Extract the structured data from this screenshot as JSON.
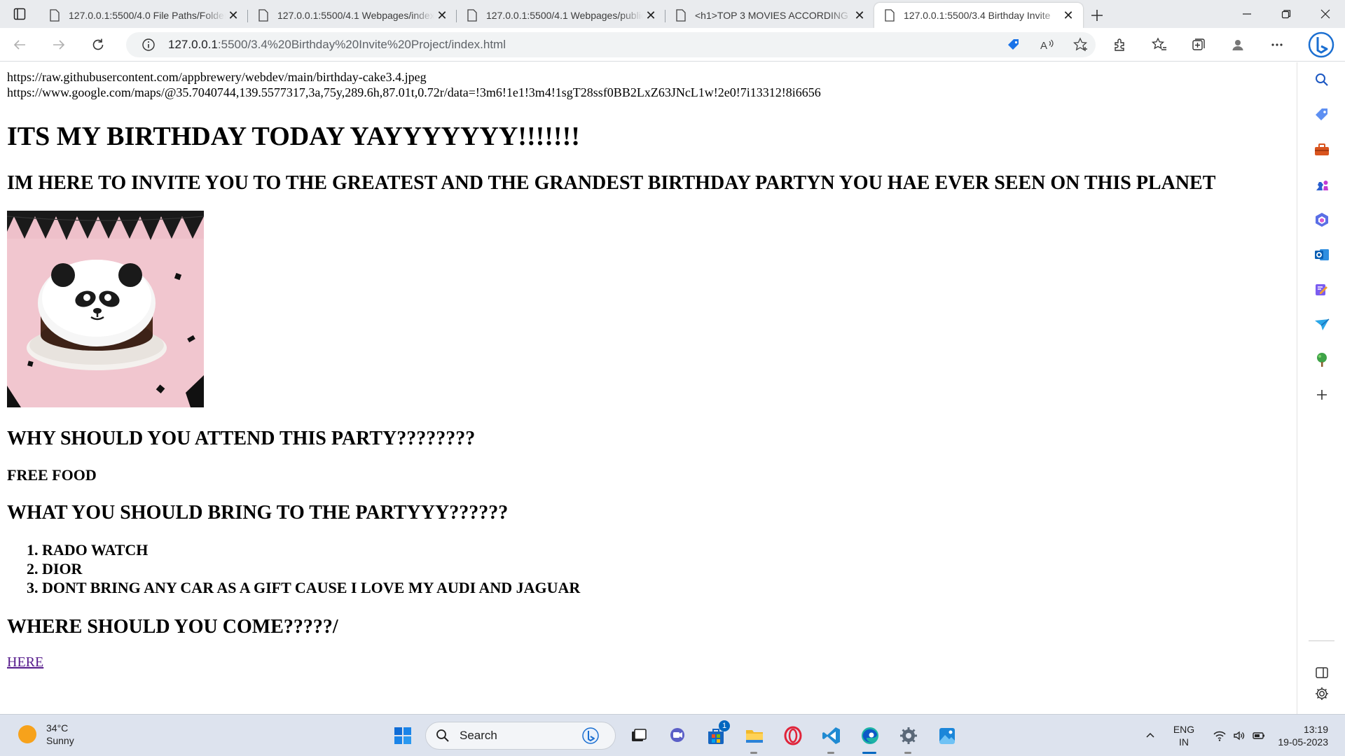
{
  "browser": {
    "tabs": [
      {
        "title": "127.0.0.1:5500/4.0 File Paths/Folder",
        "active": false
      },
      {
        "title": "127.0.0.1:5500/4.1 Webpages/index",
        "active": false
      },
      {
        "title": "127.0.0.1:5500/4.1 Webpages/public",
        "active": false
      },
      {
        "title": "<h1>TOP 3 MOVIES ACCORDING",
        "active": false
      },
      {
        "title": "127.0.0.1:5500/3.4 Birthday Invite",
        "active": true
      }
    ],
    "address": {
      "host": "127.0.0.1",
      "rest": ":5500/3.4%20Birthday%20Invite%20Project/index.html"
    }
  },
  "page": {
    "url_line_1": "https://raw.githubusercontent.com/appbrewery/webdev/main/birthday-cake3.4.jpeg",
    "url_line_2": "https://www.google.com/maps/@35.7040744,139.5577317,3a,75y,289.6h,87.01t,0.72r/data=!3m6!1e1!3m4!1sgT28ssf0BB2LxZ63JNcL1w!2e0!7i13312!8i6656",
    "heading_main": "ITS MY BIRTHDAY TODAY YAYYYYYYY!!!!!!!",
    "heading_invite": "IM HERE TO INVITE YOU TO THE GREATEST AND THE GRANDEST BIRTHDAY PARTYN YOU HAE EVER SEEN ON THIS PLANET",
    "heading_why": "WHY SHOULD YOU ATTEND THIS PARTY????????",
    "why_answer": "FREE FOOD",
    "heading_bring": "WHAT YOU SHOULD BRING TO THE PARTYYY??????",
    "bring_items": [
      "RADO WATCH",
      "DIOR",
      "DONT BRING ANY CAR AS A GIFT CAUSE I LOVE MY AUDI AND JAGUAR"
    ],
    "heading_where": "WHERE SHOULD YOU COME?????/",
    "link_text": "HERE"
  },
  "taskbar": {
    "weather_temp": "34°C",
    "weather_desc": "Sunny",
    "search_label": "Search",
    "store_badge": "1",
    "lang_1": "ENG",
    "lang_2": "IN",
    "time": "13:19",
    "date": "19-05-2023"
  },
  "colors": {
    "accent": "#0067c0",
    "link_visited": "#551a8b",
    "tab_bg": "#e9ebee",
    "taskbar_bg": "#dde3ee"
  }
}
